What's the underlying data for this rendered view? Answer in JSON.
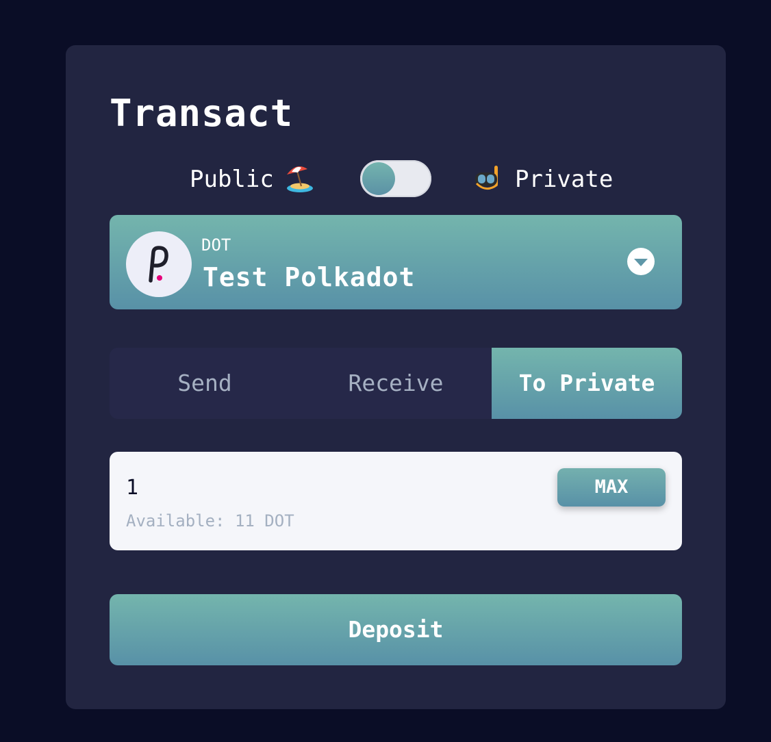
{
  "page": {
    "title": "Transact"
  },
  "mode": {
    "public_label": "Public",
    "private_label": "Private",
    "public_icon": "beach-umbrella-icon",
    "private_icon": "diving-mask-icon",
    "selected": "Public"
  },
  "token": {
    "symbol": "DOT",
    "name": "Test Polkadot",
    "logo_icon": "polkadot-logo-icon",
    "dropdown_icon": "chevron-down-icon"
  },
  "tabs": [
    {
      "label": "Send",
      "active": false
    },
    {
      "label": "Receive",
      "active": false
    },
    {
      "label": "To Private",
      "active": true
    }
  ],
  "amount": {
    "value": "1",
    "available_text": "Available: 11 DOT",
    "max_label": "MAX"
  },
  "action": {
    "deposit_label": "Deposit"
  },
  "colors": {
    "background": "#0a0d26",
    "card": "#222541",
    "accent_top": "#74b5ad",
    "accent_bottom": "#5891a7",
    "polkadot_pink": "#e6007a"
  }
}
